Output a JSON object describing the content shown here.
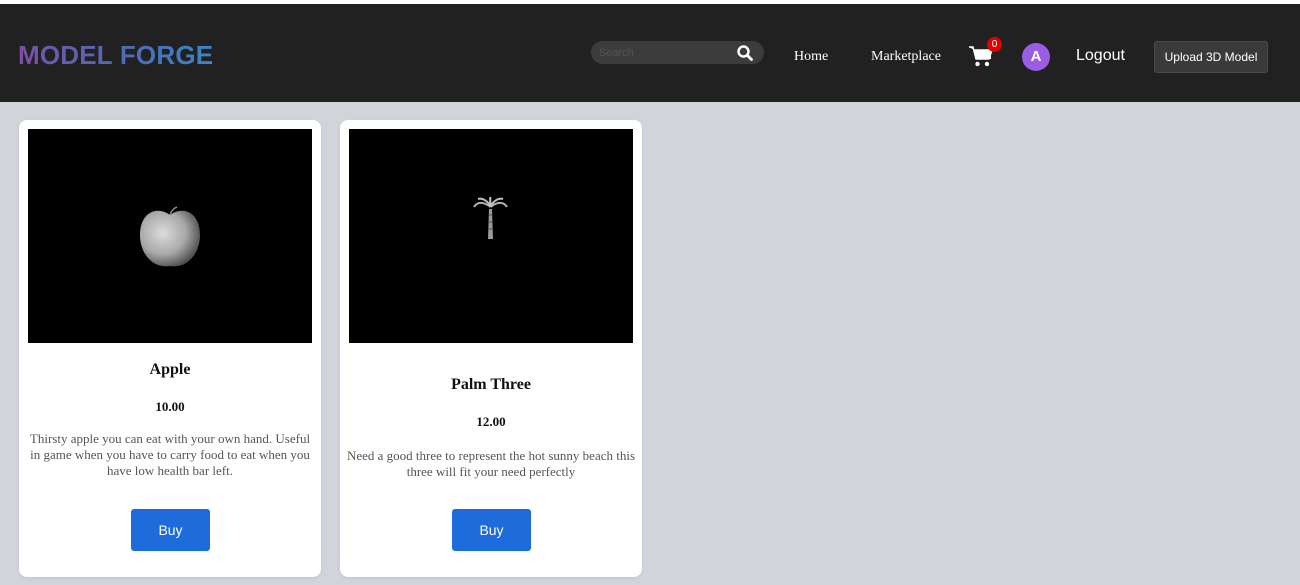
{
  "app": {
    "logo": "MODEL FORGE"
  },
  "nav": {
    "search_placeholder": "Search",
    "home": "Home",
    "marketplace": "Marketplace",
    "cart_count": "0",
    "avatar_initial": "A",
    "logout": "Logout",
    "upload": "Upload 3D Model",
    "icons": {
      "search": "search-icon",
      "cart": "cart-icon"
    }
  },
  "products": [
    {
      "title": "Apple",
      "price": "10.00",
      "description": "Thirsty apple you can eat with your own hand. Useful in game when you have to carry food to eat when you have low health bar left.",
      "buy_label": "Buy"
    },
    {
      "title": "Palm Three",
      "price": "12.00",
      "description": "Need a good three to represent the hot sunny beach this three will fit your need perfectly",
      "buy_label": "Buy"
    }
  ],
  "colors": {
    "navbar": "#212121",
    "page_background": "#d1d5da",
    "buy_button": "#1e6bdc",
    "avatar": "#9b5de5",
    "cart_badge": "#e00000"
  }
}
